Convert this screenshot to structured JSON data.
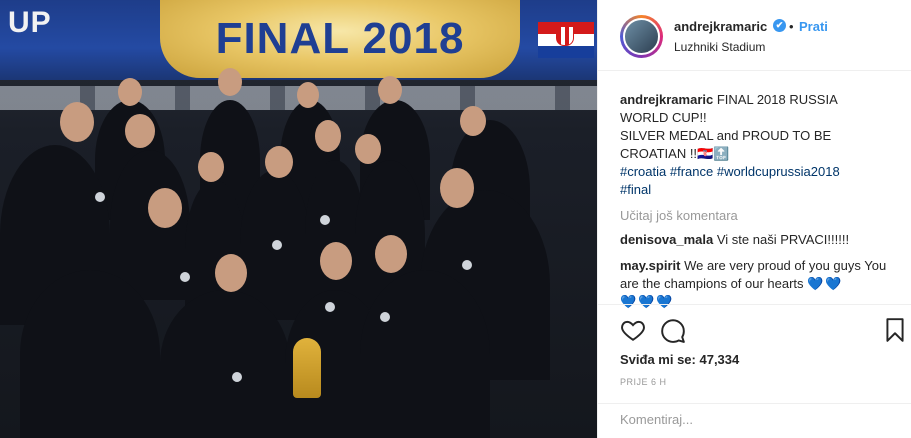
{
  "photo": {
    "banner_left": "UP",
    "banner_main": "FINAL 2018"
  },
  "post": {
    "username": "andrejkramaric",
    "verified_badge": "✔",
    "separator": "•",
    "follow_label": "Prati",
    "location": "Luzhniki Stadium"
  },
  "caption": {
    "author": "andrejkramaric",
    "text_lines": [
      "FINAL 2018 RUSSIA",
      "WORLD CUP!!",
      "SILVER MEDAL and PROUD TO BE",
      "CROATIAN !!🇭🇷🔝"
    ],
    "tags_line_1": "#croatia #france #worldcuprussia2018",
    "tags_line_2": "#final"
  },
  "load_more": "Učitaj još komentara",
  "comments": [
    {
      "user": "denisova_mala",
      "text": "Vi ste naši PRVACI!!!!!!"
    },
    {
      "user": "may.spirit",
      "text": "We are very proud of you guys You are the champions of our hearts",
      "emoji": "💙💙",
      "emoji_line": "💙💙💙"
    }
  ],
  "likes": "Sviđa mi se: 47,334",
  "timestamp": "PRIJE 6 H",
  "add_comment": {
    "placeholder": "Komentiraj..."
  },
  "icons": {
    "like": "heart-icon",
    "comment": "comment-icon",
    "save": "bookmark-icon"
  },
  "colors": {
    "link": "#3897f0",
    "hashtag": "#003569",
    "verified": "#3897f0",
    "heart_emoji": "#21b3c7"
  }
}
